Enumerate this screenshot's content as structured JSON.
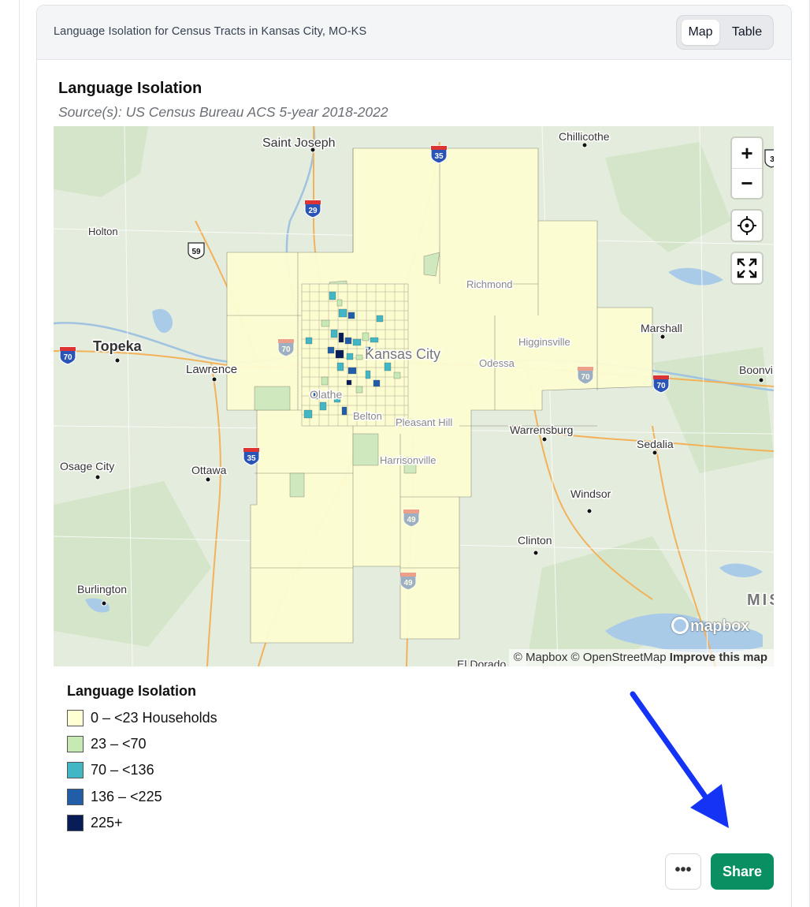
{
  "card": {
    "title": "Language Isolation for Census Tracts in Kansas City, MO-KS",
    "view_toggle": {
      "map_label": "Map",
      "table_label": "Table",
      "selected": "Map"
    }
  },
  "viz": {
    "title": "Language Isolation",
    "source": "Source(s): US Census Bureau ACS 5-year 2018-2022"
  },
  "map": {
    "places": {
      "chillicothe": "Chillicothe",
      "saint_joseph": "Saint Joseph",
      "holton": "Holton",
      "richmond": "Richmond",
      "marshall": "Marshall",
      "higginsville": "Higginsville",
      "topeka": "Topeka",
      "lawrence": "Lawrence",
      "kansas_city": "Kansas City",
      "odessa": "Odessa",
      "boonville": "Boonvi",
      "olathe": "Olathe",
      "belton": "Belton",
      "pleasant_hill": "Pleasant Hill",
      "warrensburg": "Warrensburg",
      "sedalia": "Sedalia",
      "harrisonville": "Harrisonville",
      "osage_city": "Osage City",
      "ottawa": "Ottawa",
      "windsor": "Windsor",
      "clinton": "Clinton",
      "burlington": "Burlington",
      "el_dorado": "El Dorado",
      "state_abbr": "MIS"
    },
    "shields": {
      "i35_north": "35",
      "i29": "29",
      "us59": "59",
      "i70_west": "70",
      "i70_mid": "70",
      "i70_east": "70",
      "i35_south": "35",
      "i49_a": "49",
      "i49_b": "49",
      "i70_kc": "70",
      "edge": "3"
    },
    "controls": {
      "zoom_in": "+",
      "zoom_out": "−",
      "locate_icon": "crosshair-icon",
      "fullscreen_icon": "fullscreen-icon"
    },
    "logo": "mapbox",
    "attribution": {
      "mapbox": "© Mapbox",
      "osm": "© OpenStreetMap",
      "improve": "Improve this map"
    }
  },
  "legend": {
    "title": "Language Isolation",
    "items": [
      {
        "label": "0 – <23 Households",
        "color": "#ffffd4"
      },
      {
        "label": "23 – <70",
        "color": "#c7e9b4"
      },
      {
        "label": "70 – <136",
        "color": "#41b6c4"
      },
      {
        "label": "136 – <225",
        "color": "#225ea8"
      },
      {
        "label": "225+",
        "color": "#081d58"
      }
    ]
  },
  "actions": {
    "more_label": "•••",
    "share_label": "Share"
  },
  "annotation": {
    "arrow_color": "#1433f5"
  }
}
